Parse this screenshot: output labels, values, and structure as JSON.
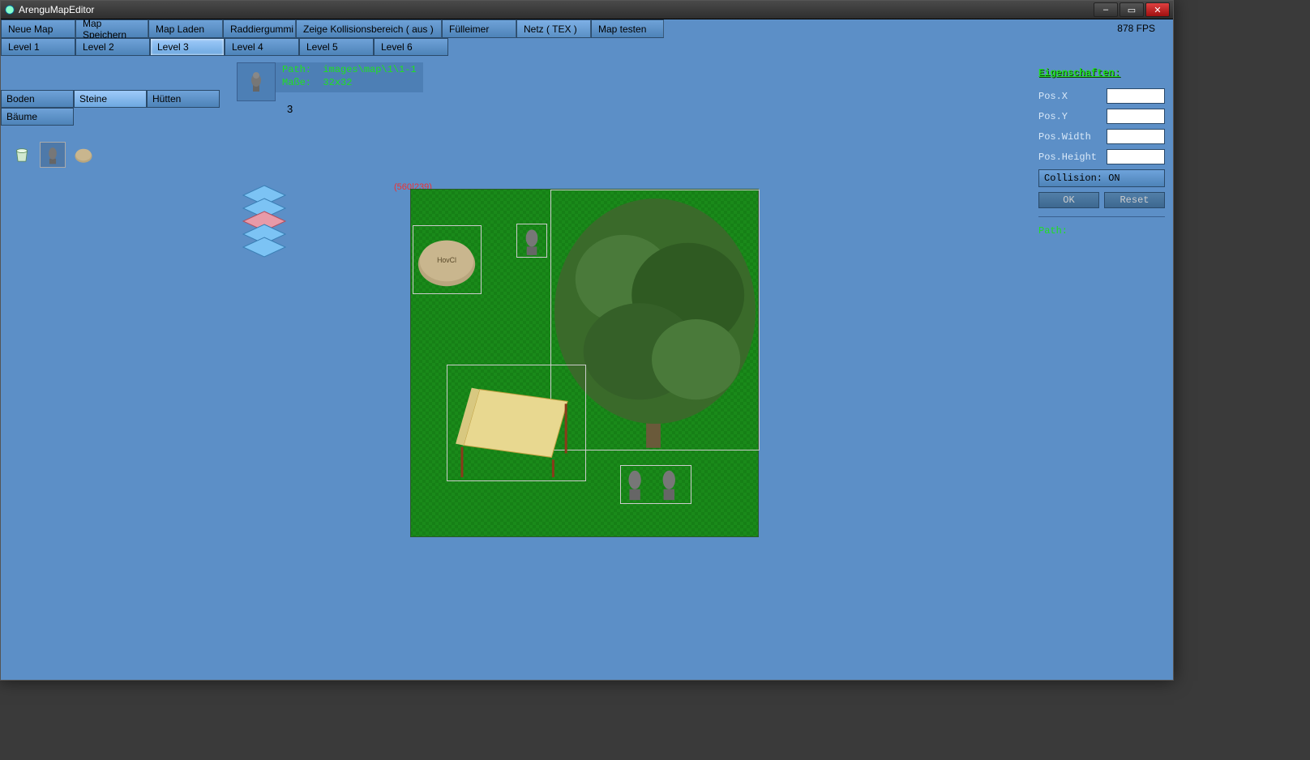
{
  "window": {
    "title": "ArenguMapEditor"
  },
  "toolbar": {
    "neue_map": "Neue Map",
    "map_speichern": "Map Speichern",
    "map_laden": "Map Laden",
    "raddiergummi": "Raddiergummi",
    "zeige_kollision": "Zeige Kollisionsbereich ( aus )",
    "fuelleimer": "Fülleimer",
    "netz": "Netz ( TEX )",
    "map_testen": "Map testen"
  },
  "fps_label": "878 FPS",
  "levels": [
    "Level 1",
    "Level 2",
    "Level 3",
    "Level 4",
    "Level 5",
    "Level 6"
  ],
  "active_level_index": 2,
  "categories": [
    "Boden",
    "Steine",
    "Hütten",
    "Bäume"
  ],
  "active_category_index": 1,
  "asset_icons": [
    "bucket",
    "statue",
    "rock"
  ],
  "selected_asset_index": 1,
  "info": {
    "path_label": "Path:",
    "path_value": "images\\map\\1\\1-1",
    "size_label": "Maße:",
    "size_value": "32x32"
  },
  "layer_number": "3",
  "cursor_coords": "(560|239)",
  "properties": {
    "header": "Eigenschaften:",
    "pos_x_label": "Pos.X",
    "pos_y_label": "Pos.Y",
    "pos_width_label": "Pos.Width",
    "pos_height_label": "Pos.Height",
    "pos_x": "",
    "pos_y": "",
    "pos_width": "",
    "pos_height": "",
    "collision_label": "Collision: ON",
    "ok_label": "OK",
    "reset_label": "Reset",
    "path_label": "Path:"
  }
}
